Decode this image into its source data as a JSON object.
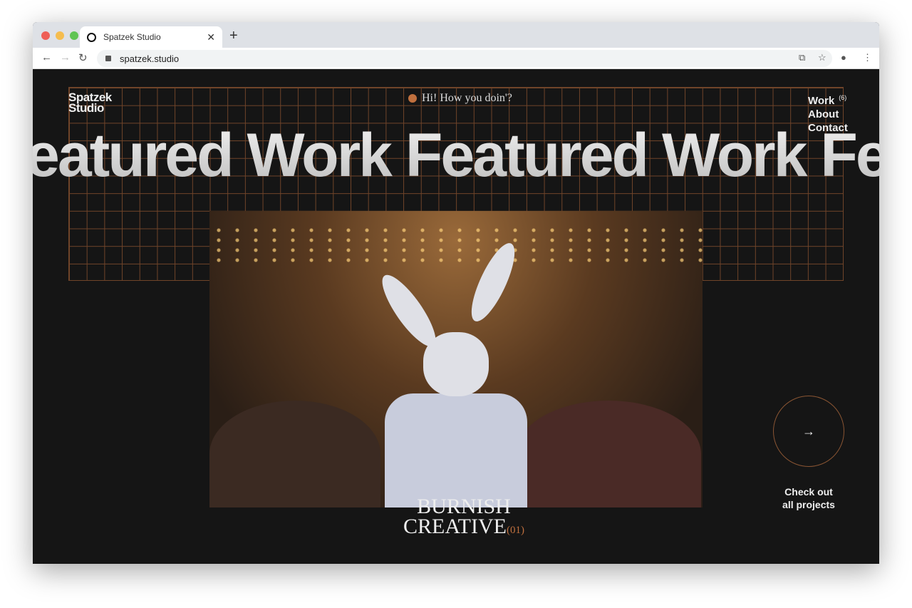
{
  "browser": {
    "tab_title": "Spatzek Studio",
    "url": "spatzek.studio"
  },
  "header": {
    "logo_line1": "Spatzek",
    "logo_line2": "Studio",
    "greeting": "Hi! How you doin'?",
    "menu": [
      {
        "label": "Work",
        "count": "(6)"
      },
      {
        "label": "About"
      },
      {
        "label": "Contact"
      }
    ]
  },
  "hero": {
    "marquee": "eatured Work Featured Work Featured Work F"
  },
  "project": {
    "name_line1": "BURNISH",
    "name_line2": "CREATIVE",
    "index": "(01)"
  },
  "cta": {
    "line1": "Check out",
    "line2": "all projects"
  },
  "colors": {
    "accent": "#c0703e",
    "background": "#151515"
  }
}
